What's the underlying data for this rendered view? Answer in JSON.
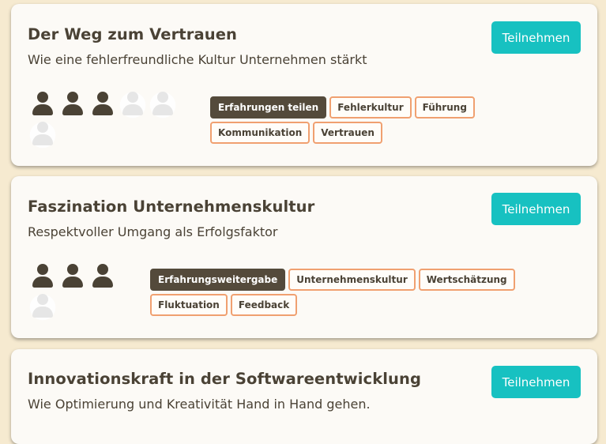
{
  "events": [
    {
      "title": "Der Weg zum Vertrauen",
      "subtitle": "Wie eine fehlerfreundliche Kultur Unternehmen stärkt",
      "button": "Teilnehmen",
      "participants_filled": 3,
      "participants_total": 6,
      "tags": [
        "Erfahrungen teilen",
        "Fehlerkultur",
        "Führung",
        "Kommunikation",
        "Vertrauen"
      ],
      "active_tag": "Erfahrungen teilen"
    },
    {
      "title": "Faszination Unternehmenskultur",
      "subtitle": "Respektvoller Umgang als Erfolgsfaktor",
      "button": "Teilnehmen",
      "participants_filled": 3,
      "participants_total": 4,
      "tags": [
        "Erfahrungsweitergabe",
        "Unternehmenskultur",
        "Wertschätzung",
        "Fluktuation",
        "Feedback"
      ],
      "active_tag": "Erfahrungsweitergabe"
    },
    {
      "title": "Innovationskraft in der Softwareentwicklung",
      "subtitle": "Wie Optimierung und Kreativität Hand in Hand gehen.",
      "button": "Teilnehmen"
    }
  ],
  "colors": {
    "background": "#f6ead0",
    "card": "#fcfaf6",
    "accent": "#17c1c1",
    "text": "#4a4235",
    "tag_border": "#f0a070",
    "tag_active": "#544a3b"
  }
}
